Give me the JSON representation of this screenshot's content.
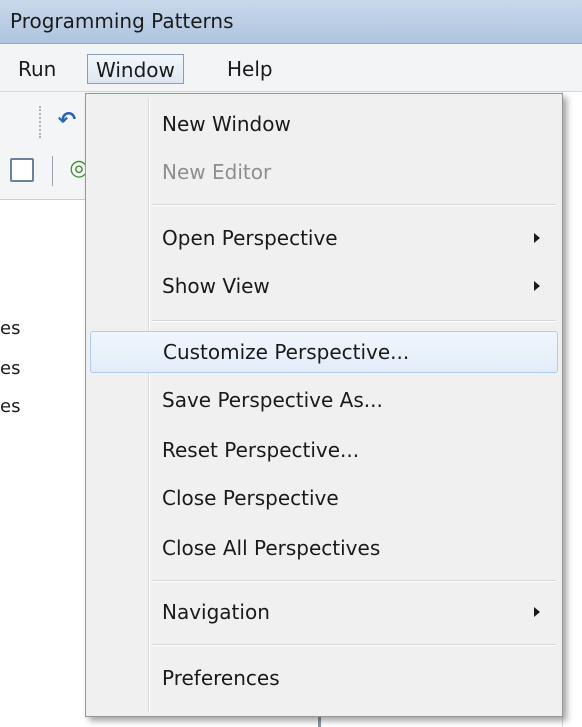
{
  "window": {
    "title": "Programming Patterns"
  },
  "menubar": {
    "items": [
      "Run",
      "Window",
      "Help"
    ]
  },
  "left_pane": {
    "fragments": [
      "es",
      "es",
      "es"
    ]
  },
  "window_menu": {
    "items": [
      {
        "label": "New Window",
        "enabled": true,
        "submenu": false
      },
      {
        "label": "New Editor",
        "enabled": false,
        "submenu": false
      },
      {
        "label": "Open Perspective",
        "enabled": true,
        "submenu": true
      },
      {
        "label": "Show View",
        "enabled": true,
        "submenu": true
      },
      {
        "label": "Customize Perspective...",
        "enabled": true,
        "submenu": false,
        "highlighted": true
      },
      {
        "label": "Save Perspective As...",
        "enabled": true,
        "submenu": false
      },
      {
        "label": "Reset Perspective...",
        "enabled": true,
        "submenu": false
      },
      {
        "label": "Close Perspective",
        "enabled": true,
        "submenu": false
      },
      {
        "label": "Close All Perspectives",
        "enabled": true,
        "submenu": false
      },
      {
        "label": "Navigation",
        "enabled": true,
        "submenu": true
      },
      {
        "label": "Preferences",
        "enabled": true,
        "submenu": false
      }
    ]
  },
  "icons": [
    "undo-icon",
    "editor-icon",
    "run-icon"
  ]
}
